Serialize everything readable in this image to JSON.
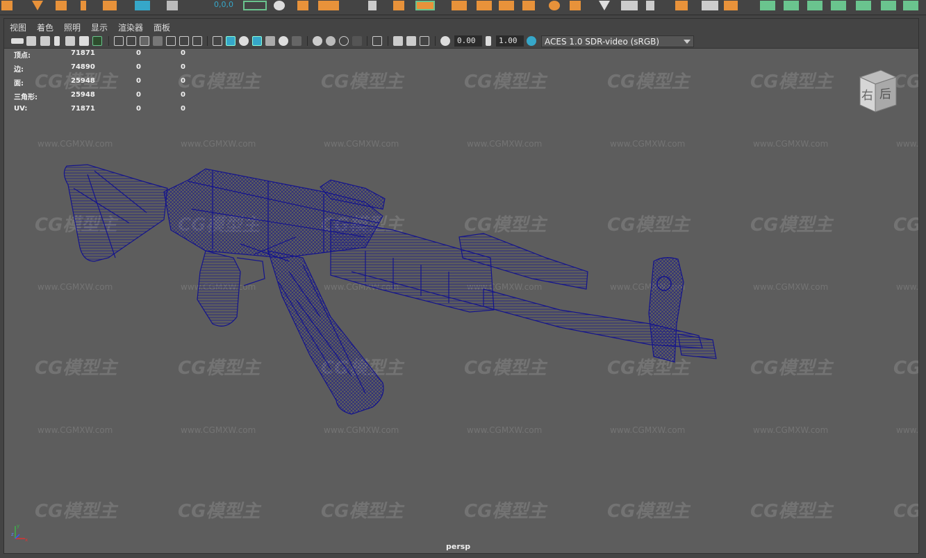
{
  "menu": [
    "视图",
    "着色",
    "照明",
    "显示",
    "渲染器",
    "面板"
  ],
  "toolbar": {
    "exposure_value": "0.00",
    "gamma_value": "1.00",
    "color_space": "ACES 1.0 SDR-video (sRGB)"
  },
  "toolbar_top_field": "0,0,0",
  "stats": [
    {
      "label": "顶点:",
      "v1": "71871",
      "v2": "0",
      "v3": "0"
    },
    {
      "label": "边:",
      "v1": "74890",
      "v2": "0",
      "v3": "0"
    },
    {
      "label": "面:",
      "v1": "25948",
      "v2": "0",
      "v3": "0"
    },
    {
      "label": "三角形:",
      "v1": "25948",
      "v2": "0",
      "v3": "0"
    },
    {
      "label": "UV:",
      "v1": "71871",
      "v2": "0",
      "v3": "0"
    }
  ],
  "camera_label": "persp",
  "viewcube": {
    "right_face": "右",
    "back_face": "后"
  },
  "watermark": {
    "logo": "CG模型主",
    "url": "www.CGMXW.com"
  },
  "axis": {
    "x": "x",
    "y": "y",
    "z": "z"
  },
  "colors": {
    "wireframe": "#14148c",
    "viewport_bg": "#5d5d5d",
    "accent_orange": "#e8923a",
    "accent_green": "#6ac48e",
    "accent_cyan": "#36a7c9"
  }
}
